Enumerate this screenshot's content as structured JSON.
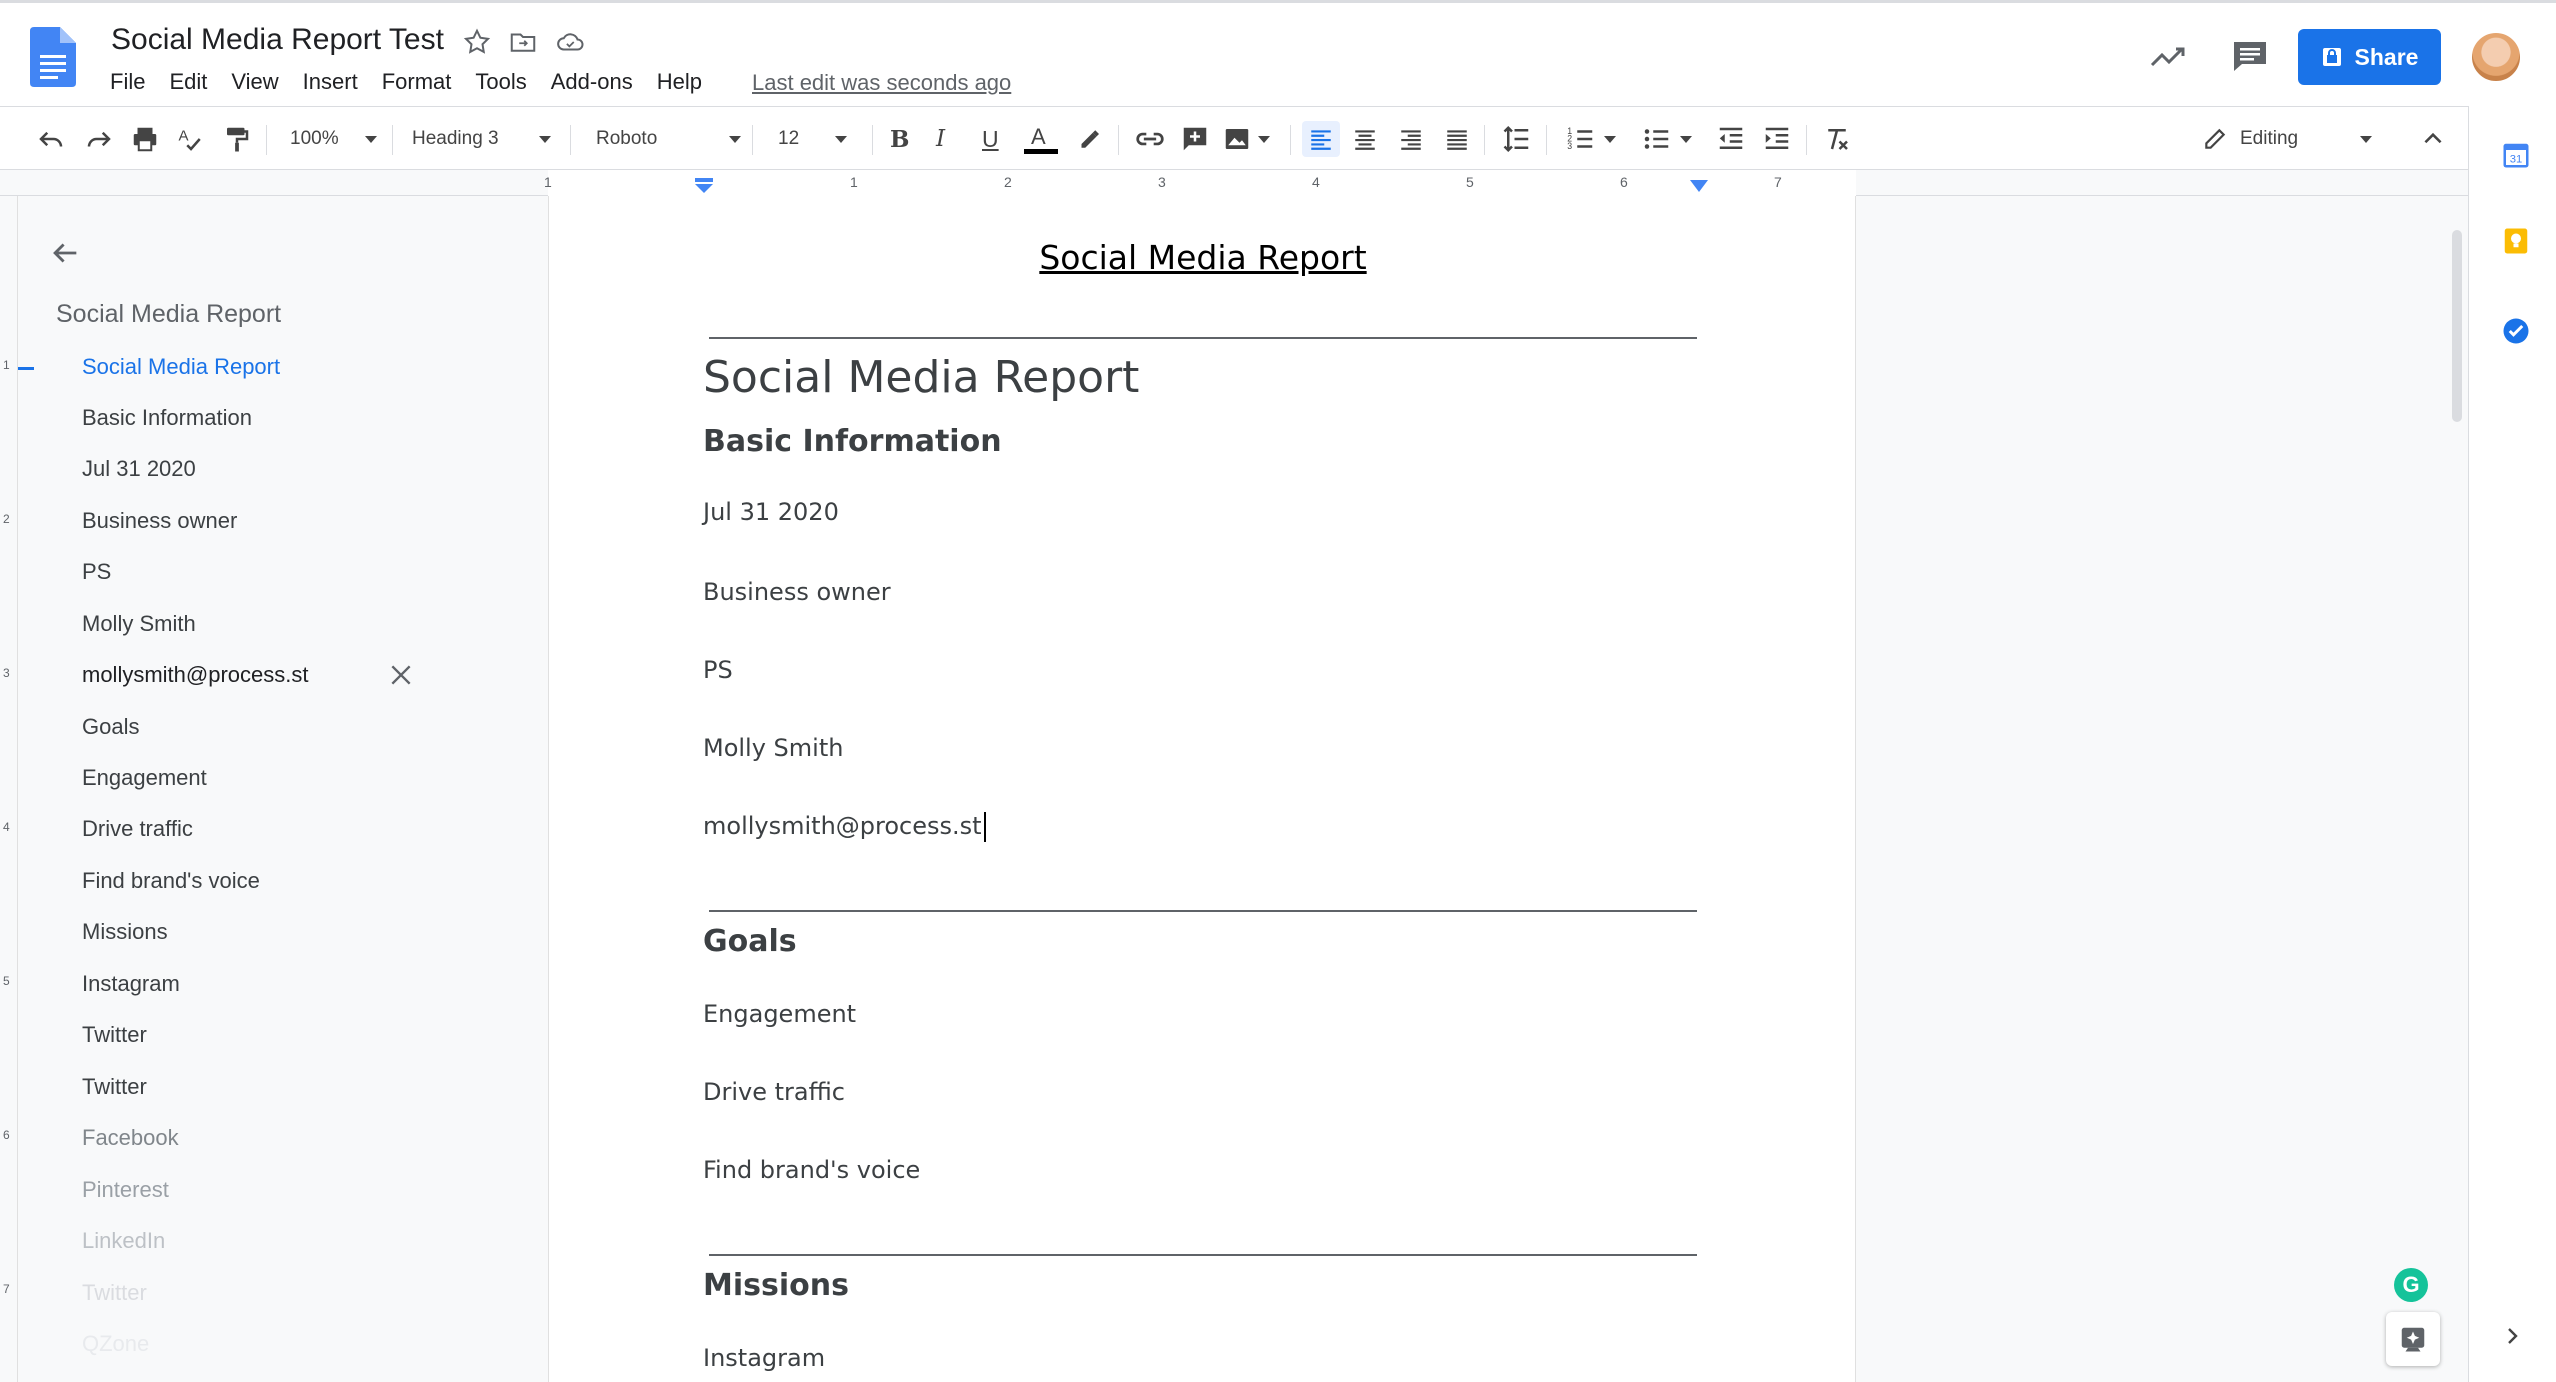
{
  "app": {
    "doc_title": "Social Media Report Test",
    "last_edit": "Last edit was seconds ago",
    "share_label": "Share",
    "menu": [
      "File",
      "Edit",
      "View",
      "Insert",
      "Format",
      "Tools",
      "Add-ons",
      "Help"
    ]
  },
  "toolbar": {
    "zoom": "100%",
    "style": "Heading 3",
    "font": "Roboto",
    "font_size": "12",
    "mode": "Editing"
  },
  "ruler": {
    "labels": [
      "1",
      "1",
      "2",
      "3",
      "4",
      "5",
      "6",
      "7"
    ]
  },
  "vruler": {
    "labels": [
      "1",
      "2",
      "3",
      "4",
      "5",
      "6",
      "7"
    ]
  },
  "outline": {
    "heading": "Social Media Report",
    "items": [
      "Social Media Report",
      "Basic Information",
      "Jul 31 2020",
      "Business owner",
      "PS",
      "Molly Smith",
      "mollysmith@process.st",
      "Goals",
      "Engagement",
      "Drive traffic",
      "Find brand's voice",
      "Missions",
      "Instagram",
      "Twitter",
      "Twitter",
      "Facebook",
      "Pinterest",
      "LinkedIn",
      "Twitter",
      "QZone"
    ]
  },
  "document": {
    "header_title": "Social Media Report",
    "title": "Social Media Report",
    "basic_heading": "Basic Information",
    "date": "Jul 31 2020",
    "role": "Business owner",
    "initials": "PS",
    "name": "Molly Smith",
    "email": "mollysmith@process.st",
    "goals_heading": "Goals",
    "goal_1": "Engagement",
    "goal_2": "Drive traffic",
    "goal_3": "Find brand's voice",
    "missions_heading": "Missions",
    "mission_1": "Instagram"
  },
  "sidepanel": {
    "calendar_day": "31"
  },
  "colors": {
    "accent": "#1a73e8",
    "text_color_underline": "#000000"
  }
}
